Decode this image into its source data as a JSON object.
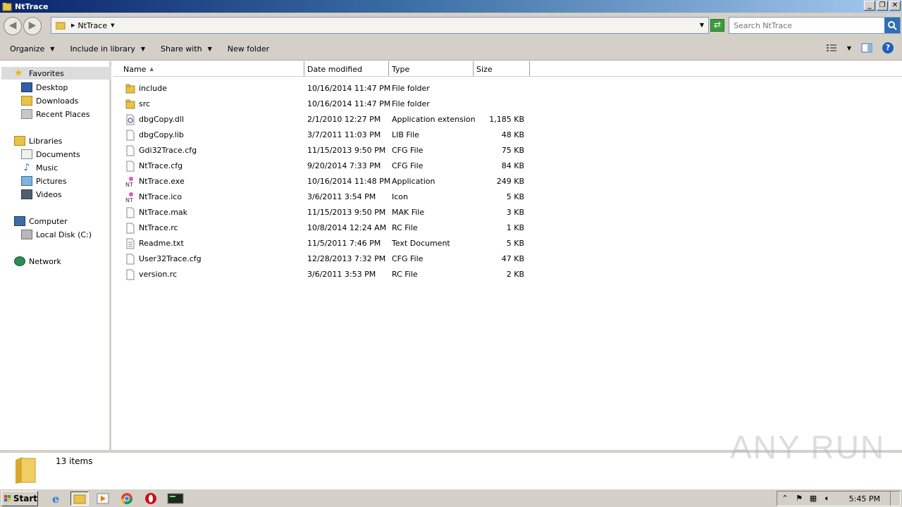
{
  "window": {
    "title": "NtTrace"
  },
  "address": {
    "crumb": "NtTrace"
  },
  "search": {
    "placeholder": "Search NtTrace"
  },
  "toolbar": {
    "organize": "Organize",
    "include_in_library": "Include in library",
    "share_with": "Share with",
    "new_folder": "New folder"
  },
  "nav": {
    "favorites": "Favorites",
    "desktop": "Desktop",
    "downloads": "Downloads",
    "recent_places": "Recent Places",
    "libraries": "Libraries",
    "documents": "Documents",
    "music": "Music",
    "pictures": "Pictures",
    "videos": "Videos",
    "computer": "Computer",
    "local_disk": "Local Disk (C:)",
    "network": "Network"
  },
  "columns": {
    "name": "Name",
    "date": "Date modified",
    "type": "Type",
    "size": "Size"
  },
  "files": [
    {
      "name": "include",
      "date": "10/16/2014 11:47 PM",
      "type": "File folder",
      "size": "",
      "icon": "folder"
    },
    {
      "name": "src",
      "date": "10/16/2014 11:47 PM",
      "type": "File folder",
      "size": "",
      "icon": "folder"
    },
    {
      "name": "dbgCopy.dll",
      "date": "2/1/2010 12:27 PM",
      "type": "Application extension",
      "size": "1,185 KB",
      "icon": "dll"
    },
    {
      "name": "dbgCopy.lib",
      "date": "3/7/2011 11:03 PM",
      "type": "LIB File",
      "size": "48 KB",
      "icon": "file"
    },
    {
      "name": "Gdi32Trace.cfg",
      "date": "11/15/2013 9:50 PM",
      "type": "CFG File",
      "size": "75 KB",
      "icon": "file"
    },
    {
      "name": "NtTrace.cfg",
      "date": "9/20/2014 7:33 PM",
      "type": "CFG File",
      "size": "84 KB",
      "icon": "file"
    },
    {
      "name": "NtTrace.exe",
      "date": "10/16/2014 11:48 PM",
      "type": "Application",
      "size": "249 KB",
      "icon": "nt"
    },
    {
      "name": "NtTrace.ico",
      "date": "3/6/2011 3:54 PM",
      "type": "Icon",
      "size": "5 KB",
      "icon": "nt"
    },
    {
      "name": "NtTrace.mak",
      "date": "11/15/2013 9:50 PM",
      "type": "MAK File",
      "size": "3 KB",
      "icon": "file"
    },
    {
      "name": "NtTrace.rc",
      "date": "10/8/2014 12:24 AM",
      "type": "RC File",
      "size": "1 KB",
      "icon": "file"
    },
    {
      "name": "Readme.txt",
      "date": "11/5/2011 7:46 PM",
      "type": "Text Document",
      "size": "5 KB",
      "icon": "txt"
    },
    {
      "name": "User32Trace.cfg",
      "date": "12/28/2013 7:32 PM",
      "type": "CFG File",
      "size": "47 KB",
      "icon": "file"
    },
    {
      "name": "version.rc",
      "date": "3/6/2011 3:53 PM",
      "type": "RC File",
      "size": "2 KB",
      "icon": "file"
    }
  ],
  "status": {
    "item_count": "13 items"
  },
  "watermark": "ANY RUN",
  "taskbar": {
    "start": "Start",
    "clock": "5:45 PM"
  }
}
